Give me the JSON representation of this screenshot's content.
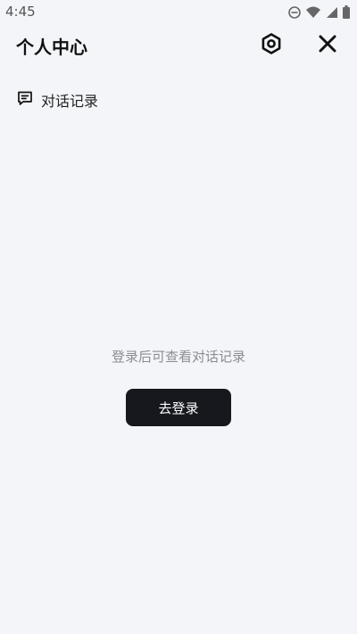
{
  "status_bar": {
    "time": "4:45",
    "icons": [
      "dnd-icon",
      "wifi-icon",
      "signal-icon",
      "battery-icon"
    ]
  },
  "header": {
    "title": "个人中心",
    "settings_icon": "settings-icon",
    "close_icon": "close-icon"
  },
  "history": {
    "label": "对话记录",
    "icon": "chat-history-icon"
  },
  "empty_state": {
    "hint": "登录后可查看对话记录",
    "login_button_label": "去登录"
  },
  "colors": {
    "background": "#f4f5f9",
    "button_bg": "#16181e",
    "button_text": "#ffffff",
    "hint_text": "#8a8d93"
  }
}
